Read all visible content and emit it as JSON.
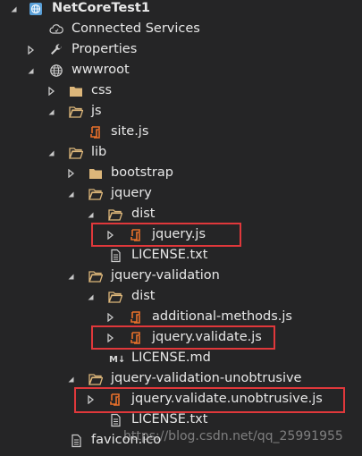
{
  "tree": {
    "project": "NetCoreTest1",
    "connected_services": "Connected Services",
    "properties": "Properties",
    "wwwroot": "wwwroot",
    "css": "css",
    "js": "js",
    "site_js": "site.js",
    "lib": "lib",
    "bootstrap": "bootstrap",
    "jquery": "jquery",
    "jquery_dist": "dist",
    "jquery_js": "jquery.js",
    "jquery_license": "LICENSE.txt",
    "jquery_validation": "jquery-validation",
    "validation_dist": "dist",
    "additional_methods": "additional-methods.js",
    "jquery_validate": "jquery.validate.js",
    "validation_license": "LICENSE.md",
    "unobtrusive": "jquery-validation-unobtrusive",
    "unobtrusive_js": "jquery.validate.unobtrusive.js",
    "unobtrusive_license": "LICENSE.txt",
    "favicon": "favicon.ico"
  },
  "watermark": "https://blog.csdn.net/qq_25991955",
  "colors": {
    "background": "#252526",
    "highlight_border": "#e0383b",
    "folder": "#dcb67a",
    "js_file": "#e8702a"
  }
}
